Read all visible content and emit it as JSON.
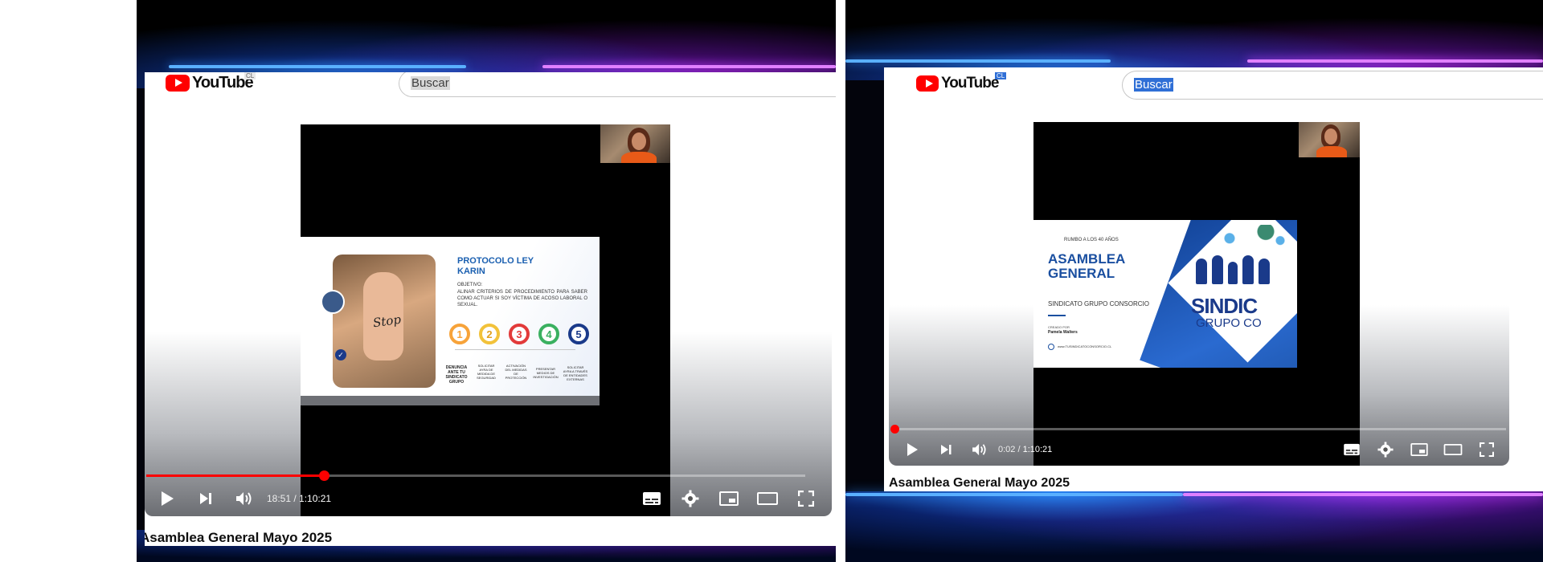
{
  "colors": {
    "youtube_red": "#ff0000",
    "neon_blue": "#2e8cff",
    "neon_purple": "#c040ff",
    "slide_blue": "#1a4fa0"
  },
  "left": {
    "logo_text": "YouTube",
    "country": "CL",
    "search_placeholder": "Buscar",
    "time_current": "18:51",
    "time_sep": " / ",
    "time_total": "1:10:21",
    "progress": 0.27,
    "video_title": "Asamblea General Mayo 2025",
    "slide": {
      "heading_line1": "PROTOCOLO LEY",
      "heading_line2": "KARIN",
      "objective_label": "OBJETIVO:",
      "objective_text": "ALINAR CRITERIOS DE PROCEDIMIENTO PARA SABER COMO ACTUAR SI SOY VÍCTIMA DE ACOSO LABORAL O SEXUAL.",
      "hand_text": "Stop",
      "steps": [
        "1",
        "2",
        "3",
        "4",
        "5"
      ],
      "step_labels": [
        "DENUNCIA ANTE TU SINDICATO GRUPO",
        "SOLICITAR AYRA DE MEDIDA DE SEGURIDAD",
        "ACTIVACIÓN DEL MEDIDAS DE PROTECCIÓN",
        "PRESENTAR MEDIOS DE INVESTIGACIÓN",
        "SOLICITAR AYRA A TRAVÉS DE ENTIDADES EXTERNAS"
      ]
    }
  },
  "right": {
    "logo_text": "YouTube",
    "country": "CL",
    "search_placeholder": "Buscar",
    "time_current": "0:02",
    "time_sep": " / ",
    "time_total": "1:10:21",
    "progress": 0.0,
    "video_title": "Asamblea General Mayo 2025",
    "slide": {
      "kicker": "RUMBO A LOS 40 AÑOS",
      "heading_line1": "ASAMBLEA",
      "heading_line2": "GENERAL",
      "subtitle": "SINDICATO GRUPO CONSORCIO",
      "created_by_label": "CREADO POR",
      "created_by_name": "Pamela Walters",
      "website": "www.TUSINDICATOCONSORCIO.CL",
      "logo_word1": "SINDIC",
      "logo_word2": "GRUPO CO"
    }
  }
}
